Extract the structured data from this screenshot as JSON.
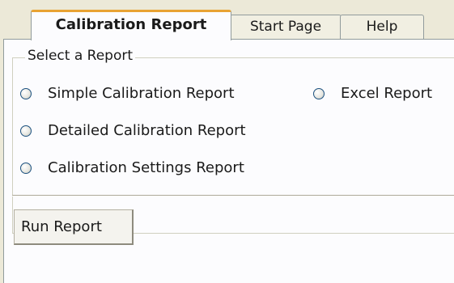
{
  "tabs": [
    {
      "label": "Calibration Report",
      "active": true
    },
    {
      "label": "Start Page",
      "active": false
    },
    {
      "label": "Help",
      "active": false
    }
  ],
  "report_group": {
    "legend": "Select a Report",
    "options": [
      {
        "label": "Simple Calibration Report",
        "selected": false
      },
      {
        "label": "Excel Report",
        "selected": false
      },
      {
        "label": "Detailed Calibration Report",
        "selected": false
      },
      {
        "label": "Calibration Settings Report",
        "selected": false
      }
    ]
  },
  "actions": {
    "run_label": "Run Report"
  },
  "colors": {
    "background": "#ece9d8",
    "panel": "#fcfcfe",
    "active_tab_accent": "#e8a333",
    "border": "#919b9c"
  }
}
